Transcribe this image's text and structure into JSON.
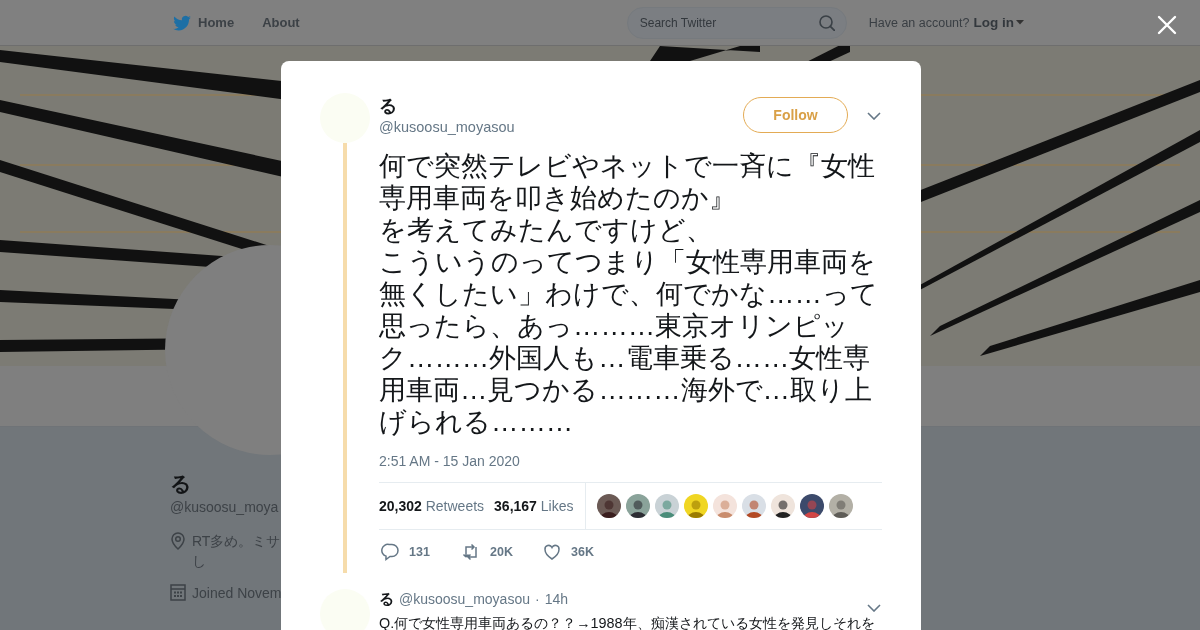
{
  "top_bar": {
    "nav": [
      {
        "label": "Home",
        "kind": "bird"
      },
      {
        "label": "About",
        "kind": "plain"
      }
    ],
    "search": {
      "placeholder": "Search Twitter"
    },
    "account_prompt": "Have an account?",
    "login": "Log in"
  },
  "profile": {
    "name": "る",
    "handle": "@kusoosu_moya",
    "bio_lines": [
      "RT多め。ミサ",
      "し"
    ],
    "joined": "Joined Novem"
  },
  "tweet": {
    "name": "る",
    "handle": "@kusoosu_moyasou",
    "follow_label": "Follow",
    "paragraphs": [
      "何で突然テレビやネットで一斉に『女性専用車両を叩き始めたのか』",
      "を考えてみたんですけど、",
      "こういうのってつまり「女性専用車両を無くしたい」わけで、何でかな……って思ったら、あっ………東京オリンピック………外国人も…電車乗る……女性専用車両…見つかる………海外で…取り上げられる………"
    ],
    "timestamp": "2:51 AM - 15 Jan 2020",
    "retweets": {
      "count": "20,302",
      "label": "Retweets"
    },
    "likes": {
      "count": "36,167",
      "label": "Likes"
    },
    "actions": [
      {
        "kind": "reply",
        "count": "131"
      },
      {
        "kind": "retweet",
        "count": "20K"
      },
      {
        "kind": "like",
        "count": "36K"
      }
    ]
  },
  "replies": [
    {
      "name": "る",
      "handle": "@kusoosu_moyasou",
      "separator": "·",
      "time": "14h",
      "text": "Q.何で女性専用車両あるの？？→1988年、痴漢されている女性を発見しそれを"
    }
  ]
}
